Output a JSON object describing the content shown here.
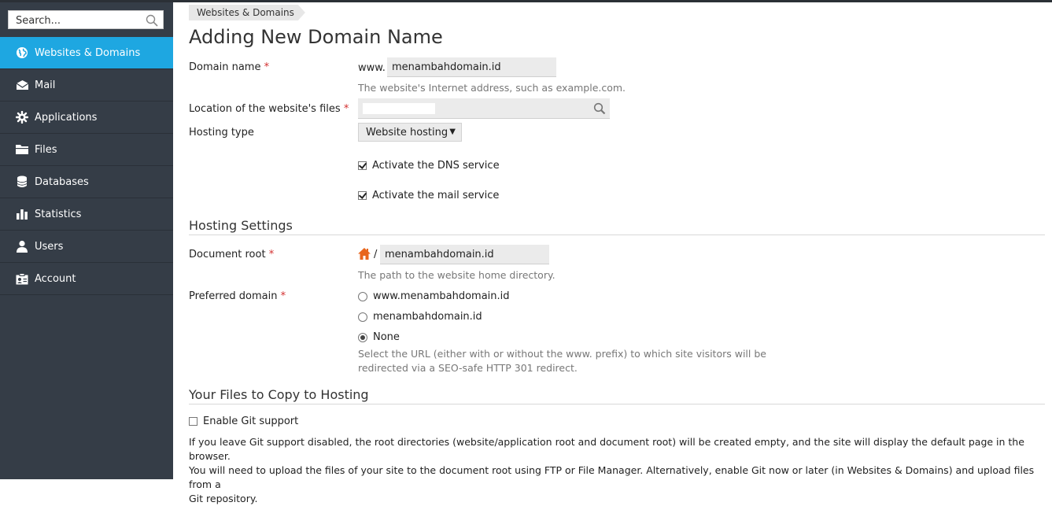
{
  "sidebar": {
    "search": {
      "placeholder": "Search..."
    },
    "items": [
      {
        "label": "Websites & Domains",
        "icon": "globe-icon",
        "active": true
      },
      {
        "label": "Mail",
        "icon": "envelope-icon"
      },
      {
        "label": "Applications",
        "icon": "gear-icon"
      },
      {
        "label": "Files",
        "icon": "folder-icon"
      },
      {
        "label": "Databases",
        "icon": "database-icon"
      },
      {
        "label": "Statistics",
        "icon": "bar-chart-icon"
      },
      {
        "label": "Users",
        "icon": "user-icon"
      },
      {
        "label": "Account",
        "icon": "id-card-icon"
      }
    ]
  },
  "main": {
    "breadcrumb": "Websites & Domains",
    "title": "Adding New Domain Name",
    "form": {
      "domain_name": {
        "label": "Domain name",
        "required": "*",
        "prefix": "www.",
        "value": "menambahdomain.id",
        "hint": "The website's Internet address, such as example.com."
      },
      "location": {
        "label": "Location of the website's files",
        "required": "*",
        "value": ""
      },
      "hosting_type": {
        "label": "Hosting type",
        "value": "Website hosting"
      },
      "dns": {
        "label": "Activate the DNS service",
        "checked": true
      },
      "mail": {
        "label": "Activate the mail service",
        "checked": true
      }
    },
    "hosting_settings": {
      "title": "Hosting Settings",
      "document_root": {
        "label": "Document root",
        "required": "*",
        "separator": "/",
        "value": "menambahdomain.id",
        "hint": "The path to the website home directory."
      },
      "preferred_domain": {
        "label": "Preferred domain",
        "required": "*",
        "options": [
          "www.menambahdomain.id",
          "menambahdomain.id",
          "None"
        ],
        "selected": "None",
        "hint_line1": "Select the URL (either with or without the www. prefix) to which site visitors will be",
        "hint_line2": "redirected via a SEO-safe HTTP 301 redirect."
      }
    },
    "files": {
      "title": "Your Files to Copy to Hosting",
      "git": {
        "label": "Enable Git support",
        "checked": false
      },
      "info_line1": "If you leave Git support disabled, the root directories (website/application root and document root) will be created empty, and the site will display the default page in the browser.",
      "info_line2": "You will need to upload the files of your site to the document root using FTP or File Manager. Alternatively, enable Git now or later (in Websites & Domains) and upload files from a",
      "info_line3": "Git repository."
    }
  },
  "colors": {
    "sidebar_bg": "#353d47",
    "active_bg": "#1ea7e1",
    "required": "#d32f2f",
    "home_icon": "#e8661d"
  }
}
